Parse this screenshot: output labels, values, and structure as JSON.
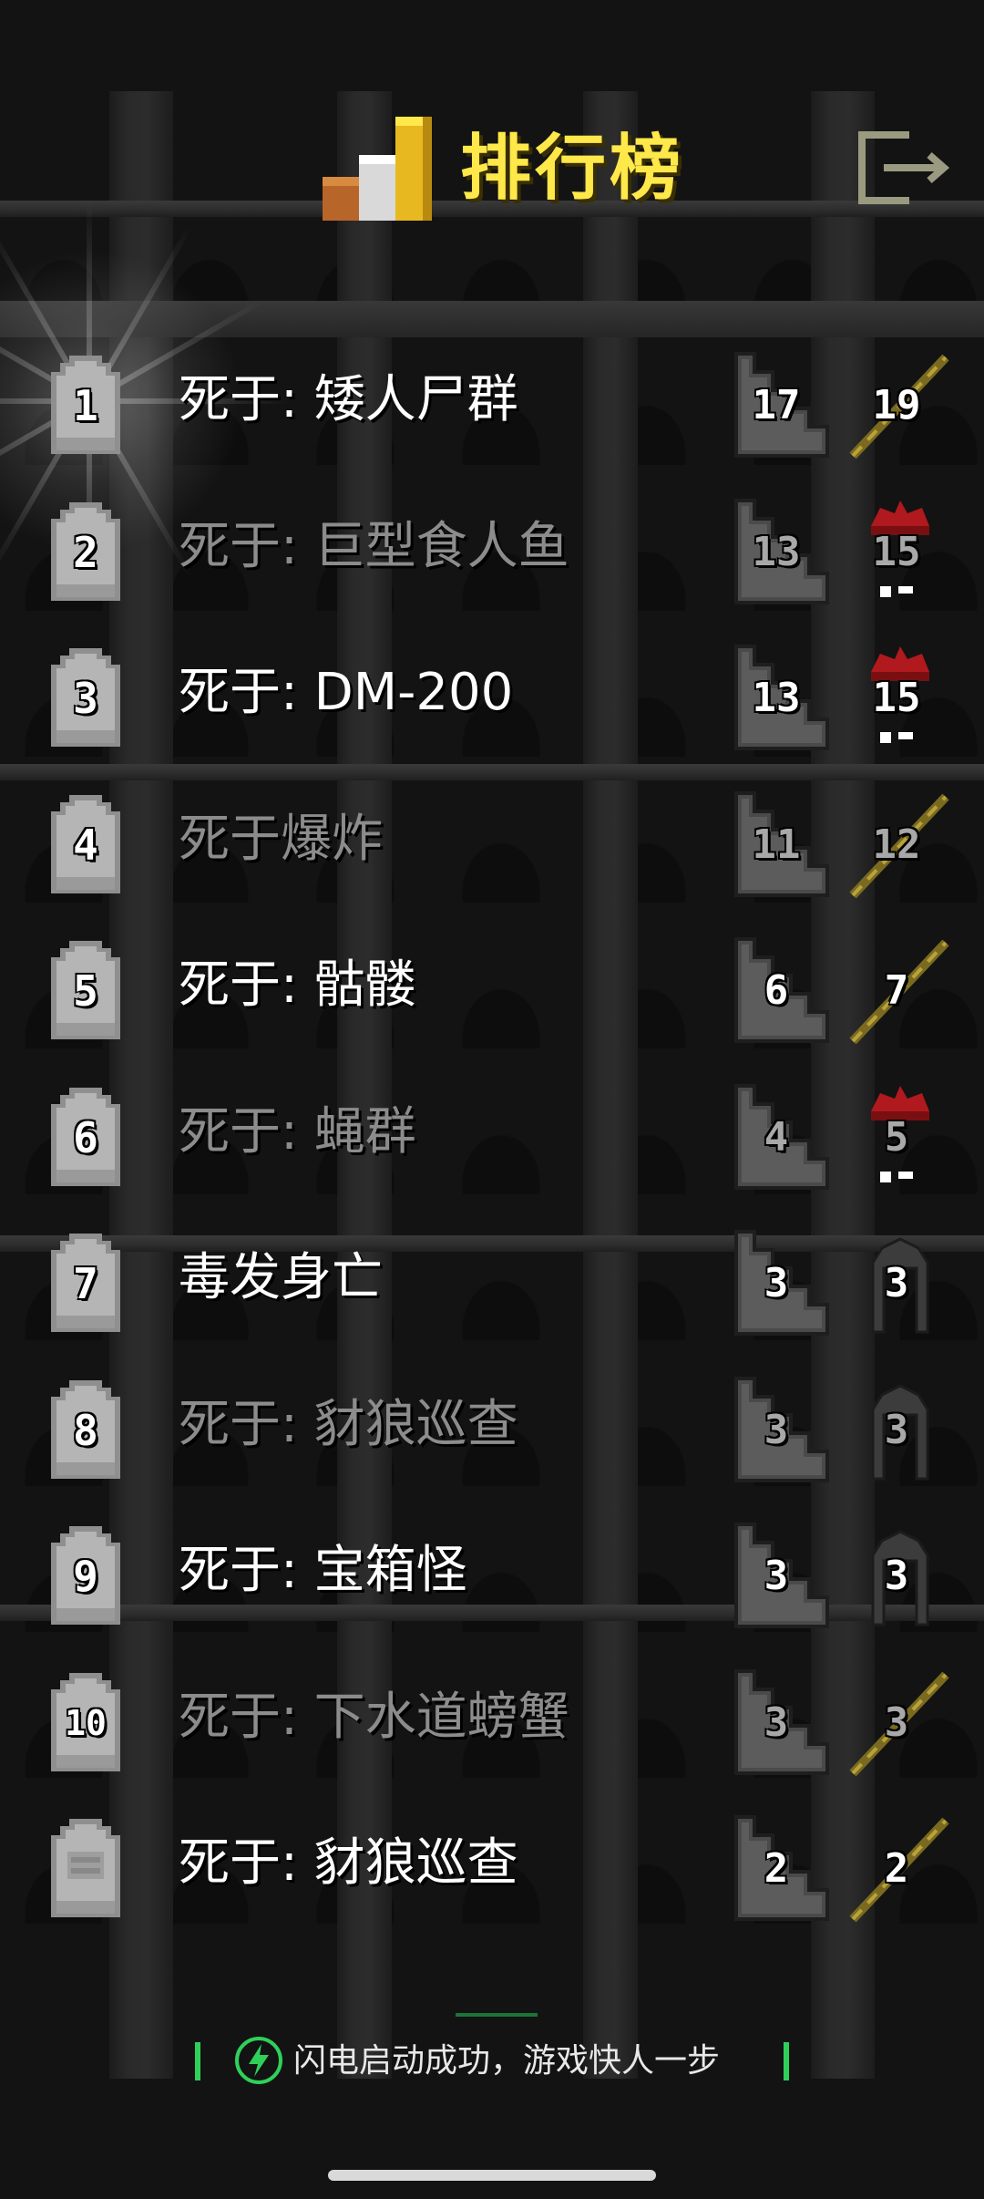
{
  "header": {
    "title": "排行榜",
    "trophy_icon": "trophy-bars-icon",
    "exit_icon": "exit-door-icon"
  },
  "colors": {
    "title": "#ffe84a",
    "text_bright": "#ffffff",
    "text_dim": "#8c8c8c",
    "banner_accent": "#2fd05a"
  },
  "entries": [
    {
      "rank": "1",
      "cause": "死于:  矮人尸群",
      "depth": "17",
      "level": "19",
      "class_icon": "wand-icon",
      "dim": false
    },
    {
      "rank": "2",
      "cause": "死于:  巨型食人鱼",
      "depth": "13",
      "level": "15",
      "class_icon": "red-helmet-icon",
      "dim": true
    },
    {
      "rank": "3",
      "cause": "死于:  DM-200",
      "depth": "13",
      "level": "15",
      "class_icon": "red-helmet-icon",
      "dim": false
    },
    {
      "rank": "4",
      "cause": "死于爆炸",
      "depth": "11",
      "level": "12",
      "class_icon": "wand-icon",
      "dim": true
    },
    {
      "rank": "5",
      "cause": "死于:  骷髅",
      "depth": "6",
      "level": "7",
      "class_icon": "wand-icon",
      "dim": false
    },
    {
      "rank": "6",
      "cause": "死于:  蝇群",
      "depth": "4",
      "level": "5",
      "class_icon": "red-helmet-icon",
      "dim": true
    },
    {
      "rank": "7",
      "cause": "毒发身亡",
      "depth": "3",
      "level": "3",
      "class_icon": "hood-icon",
      "dim": false
    },
    {
      "rank": "8",
      "cause": "死于:  豺狼巡查",
      "depth": "3",
      "level": "3",
      "class_icon": "hood-icon",
      "dim": true
    },
    {
      "rank": "9",
      "cause": "死于:  宝箱怪",
      "depth": "3",
      "level": "3",
      "class_icon": "hood-icon",
      "dim": false
    },
    {
      "rank": "10",
      "cause": "死于:  下水道螃蟹",
      "depth": "3",
      "level": "3",
      "class_icon": "wand-icon",
      "dim": true
    },
    {
      "rank": "",
      "cause": "死于:  豺狼巡查",
      "depth": "2",
      "level": "2",
      "class_icon": "wand-icon",
      "dim": false
    }
  ],
  "banner": {
    "text": "闪电启动成功，游戏快人一步",
    "icon": "lightning-icon"
  }
}
